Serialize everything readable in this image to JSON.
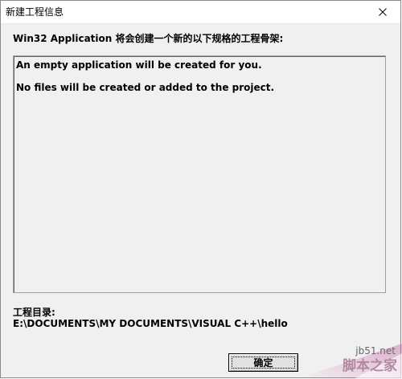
{
  "window": {
    "title": "新建工程信息"
  },
  "header": {
    "text": "Win32 Application 将会创建一个新的以下规格的工程骨架:"
  },
  "content": {
    "messages": [
      "An empty application will be created for you.",
      "No files will be created or added to the project."
    ]
  },
  "directory": {
    "label": "工程目录:",
    "path": "E:\\DOCUMENTS\\MY DOCUMENTS\\VISUAL C++\\hello"
  },
  "buttons": {
    "ok_label": "确定"
  },
  "watermark": {
    "url": "jb51.net",
    "text": "脚本之家"
  },
  "colors": {
    "dialog_bg": "#f0f0f0",
    "titlebar_bg": "#ffffff",
    "watermark_accent": "#c060a0"
  }
}
